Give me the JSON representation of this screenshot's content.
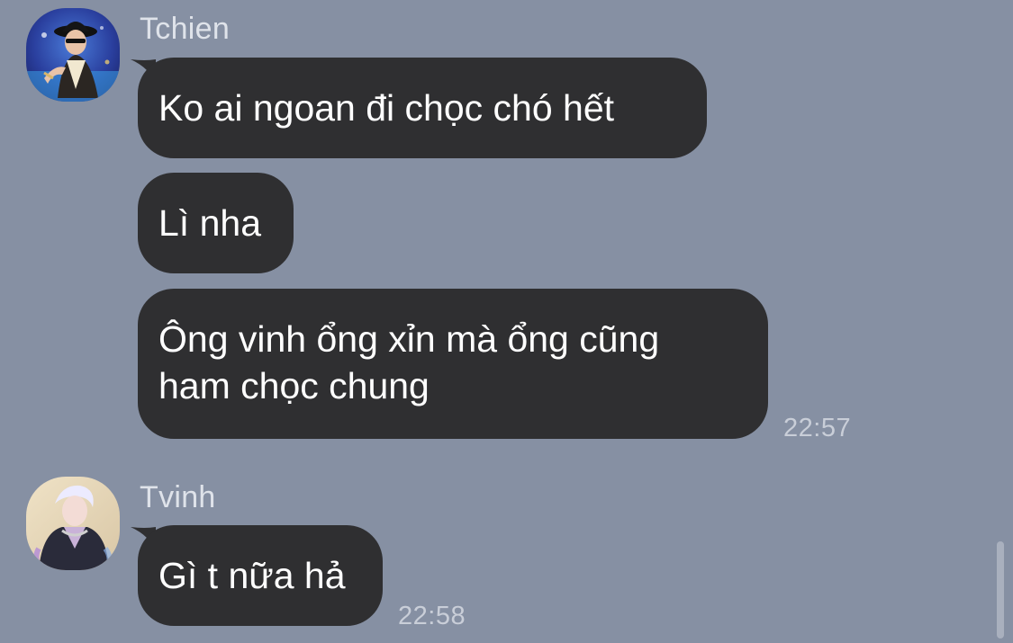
{
  "conversation": {
    "groups": [
      {
        "sender": "Tchien",
        "avatar_icon": "user-avatar-tchien",
        "messages": [
          "Ko ai ngoan đi chọc chó hết",
          "Lì nha",
          "Ông vinh ổng xỉn mà ổng cũng\nham chọc chung"
        ],
        "time": "22:57"
      },
      {
        "sender": "Tvinh",
        "avatar_icon": "user-avatar-tvinh",
        "messages": [
          "Gì t nữa hả"
        ],
        "time": "22:58"
      }
    ]
  },
  "colors": {
    "background": "#8690a3",
    "bubble": "#2f2f31",
    "bubble_text": "#ffffff",
    "meta_text": "#dfe3ea"
  }
}
